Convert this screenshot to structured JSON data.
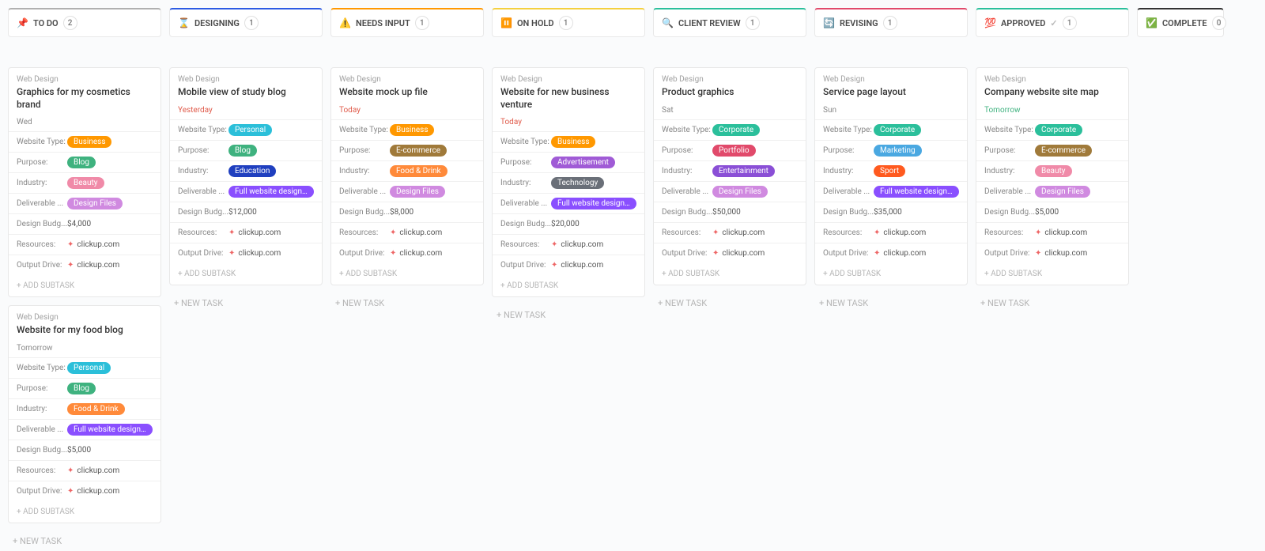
{
  "labels": {
    "add_subtask": "+ ADD SUBTASK",
    "new_task": "+ NEW TASK",
    "category": "Web Design",
    "fields": {
      "website_type": "Website Type:",
      "purpose": "Purpose:",
      "industry": "Industry:",
      "deliverable": "Deliverable ...",
      "design_budget": "Design Budg...",
      "resources": "Resources:",
      "output_drive": "Output Drive:"
    },
    "link_text": "clickup.com"
  },
  "tag_colors": {
    "Business": "#ff9800",
    "Personal": "#2bbfd9",
    "Corporate": "#2bbf9b",
    "Blog": "#3fb27f",
    "E-commerce": "#a07a3a",
    "Advertisement": "#a05bd6",
    "Portfolio": "#e14a6b",
    "Marketing": "#4aa8e1",
    "Beauty": "#f08aa8",
    "Education": "#1f3fbf",
    "Food & Drink": "#ff8a3a",
    "Technology": "#6a6f78",
    "Entertainment": "#8a4fd6",
    "Sport": "#ff5a1f",
    "Design Files": "#d08ae0",
    "Full website design and lay...": "#8a4fff"
  },
  "columns": [
    {
      "name": "TO DO",
      "icon": "📌",
      "accent": "#b0b0b0",
      "count": 2,
      "check": false,
      "cards": [
        {
          "title": "Graphics for my cosmetics brand",
          "date": "Wed",
          "date_style": "",
          "website_type": "Business",
          "purpose": "Blog",
          "industry": "Beauty",
          "deliverable": "Design Files",
          "budget": "$4,000"
        },
        {
          "title": "Website for my food blog",
          "date": "Tomorrow",
          "date_style": "",
          "website_type": "Personal",
          "purpose": "Blog",
          "industry": "Food & Drink",
          "deliverable": "Full website design and lay...",
          "budget": "$5,000"
        }
      ]
    },
    {
      "name": "DESIGNING",
      "icon": "⌛",
      "accent": "#2d5be3",
      "count": 1,
      "check": false,
      "cards": [
        {
          "title": "Mobile view of study blog",
          "date": "Yesterday",
          "date_style": "red",
          "website_type": "Personal",
          "purpose": "Blog",
          "industry": "Education",
          "deliverable": "Full website design and lay...",
          "budget": "$12,000"
        }
      ]
    },
    {
      "name": "NEEDS INPUT",
      "icon": "⚠️",
      "accent": "#ff9800",
      "count": 1,
      "check": false,
      "cards": [
        {
          "title": "Website mock up file",
          "date": "Today",
          "date_style": "red",
          "website_type": "Business",
          "purpose": "E-commerce",
          "industry": "Food & Drink",
          "deliverable": "Design Files",
          "budget": "$8,000"
        }
      ]
    },
    {
      "name": "ON HOLD",
      "icon": "⏸️",
      "accent": "#f4d03f",
      "count": 1,
      "check": false,
      "cards": [
        {
          "title": "Website for new business venture",
          "date": "Today",
          "date_style": "red",
          "website_type": "Business",
          "purpose": "Advertisement",
          "industry": "Technology",
          "deliverable": "Full website design and lay...",
          "budget": "$20,000"
        }
      ]
    },
    {
      "name": "CLIENT REVIEW",
      "icon": "🔍",
      "accent": "#2bbf9b",
      "count": 1,
      "check": false,
      "cards": [
        {
          "title": "Product graphics",
          "date": "Sat",
          "date_style": "",
          "website_type": "Corporate",
          "purpose": "Portfolio",
          "industry": "Entertainment",
          "deliverable": "Design Files",
          "budget": "$50,000"
        }
      ]
    },
    {
      "name": "REVISING",
      "icon": "🔄",
      "accent": "#e14a6b",
      "count": 1,
      "check": false,
      "cards": [
        {
          "title": "Service page layout",
          "date": "Sun",
          "date_style": "",
          "website_type": "Corporate",
          "purpose": "Marketing",
          "industry": "Sport",
          "deliverable": "Full website design and lay...",
          "budget": "$35,000"
        }
      ]
    },
    {
      "name": "APPROVED",
      "icon": "💯",
      "accent": "#2bbf9b",
      "count": 1,
      "check": true,
      "cards": [
        {
          "title": "Company website site map",
          "date": "Tomorrow",
          "date_style": "green",
          "website_type": "Corporate",
          "purpose": "E-commerce",
          "industry": "Beauty",
          "deliverable": "Design Files",
          "budget": "$5,000"
        }
      ]
    },
    {
      "name": "COMPLETE",
      "icon": "✅",
      "accent": "#333",
      "count": 0,
      "check": false,
      "narrow": true,
      "cards": []
    }
  ]
}
